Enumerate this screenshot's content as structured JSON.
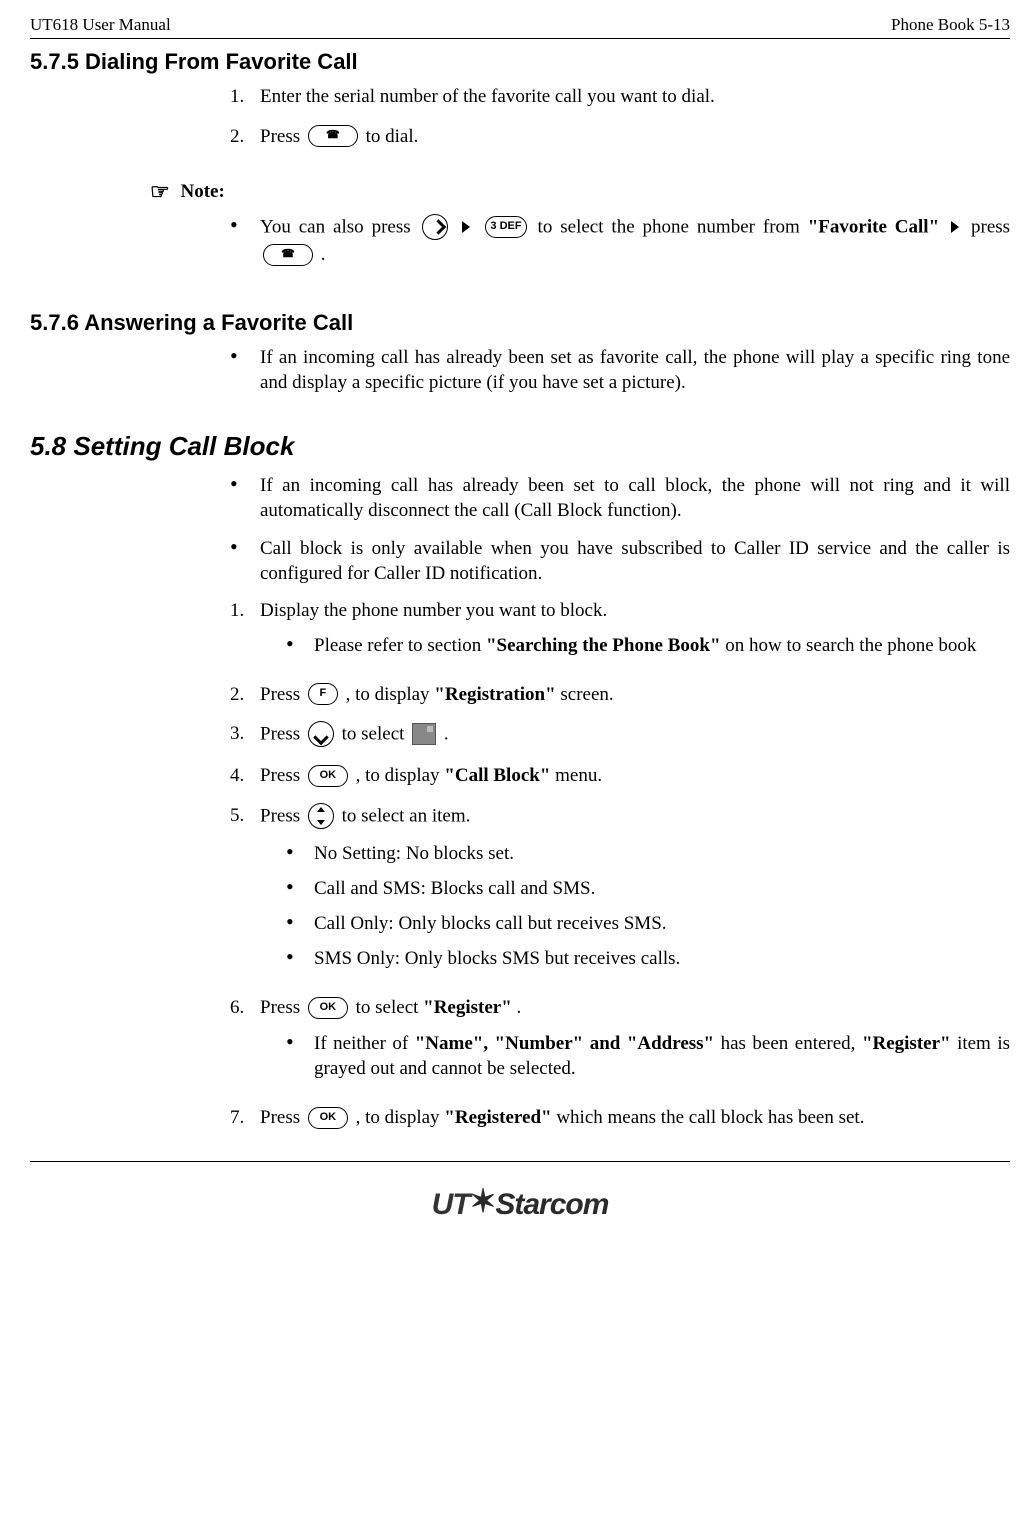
{
  "header": {
    "left": "UT618 User Manual",
    "right": "Phone Book   5-13"
  },
  "sec575": {
    "heading": "5.7.5 Dialing From Favorite Call",
    "step1": "Enter the serial number of the favorite call you want to dial.",
    "step2_a": "Press ",
    "step2_b": " to dial.",
    "note_label": " Note:",
    "note_a": "You can also press ",
    "note_b": " to select the phone number from ",
    "note_bold1": "\"Favorite Call\"",
    "note_c": " press ",
    "note_d": "."
  },
  "sec576": {
    "heading": "5.7.6 Answering a Favorite Call",
    "bullet": "If an incoming call has already been set as favorite call, the phone will play a specific ring tone and display a specific picture (if you have set a picture)."
  },
  "sec58": {
    "heading": "5.8   Setting Call Block",
    "b1": "If an incoming call has already been set to call block, the phone will not ring and it will automatically disconnect the call (Call Block function).",
    "b2": "Call block is only available when you have subscribed to Caller ID service and the caller is configured for Caller ID notification.",
    "s1": "Display the phone number you want to block.",
    "s1_sub_a": "Please refer to section ",
    "s1_sub_bold": "\"Searching the Phone Book\"",
    "s1_sub_b": " on how to search the phone book",
    "s2_a": "Press ",
    "s2_b": ", to display ",
    "s2_bold": "\"Registration\"",
    "s2_c": " screen.",
    "s3_a": "Press ",
    "s3_b": " to select ",
    "s3_c": " .",
    "s4_a": "Press ",
    "s4_b": ", to display ",
    "s4_bold": "\"Call Block\"",
    "s4_c": " menu.",
    "s5_a": "Press ",
    "s5_b": " to select an item.",
    "s5_opt1": "No Setting: No blocks set.",
    "s5_opt2": "Call and SMS: Blocks call and SMS.",
    "s5_opt3": "Call Only: Only blocks call but receives SMS.",
    "s5_opt4": "SMS Only: Only blocks SMS but receives calls.",
    "s6_a": "Press ",
    "s6_b": " to select ",
    "s6_bold": "\"Register\"",
    "s6_c": ".",
    "s6_sub_a": "If  neither of ",
    "s6_sub_bold": "\"Name\", \"Number\" and \"Address\"",
    "s6_sub_b": " has been entered, ",
    "s6_sub_bold2": "\"Register\"",
    "s6_sub_c": " item is grayed out and cannot be selected.",
    "s7_a": "Press ",
    "s7_b": ", to display ",
    "s7_bold": "\"Registered\"",
    "s7_c": " which means the call block has been set."
  },
  "icons": {
    "call_key": "☎",
    "num3_key": "3 DEF",
    "f_key": "F",
    "ok_key": "OK"
  },
  "footer": {
    "logo_a": "UT",
    "logo_b": "Starcom"
  }
}
